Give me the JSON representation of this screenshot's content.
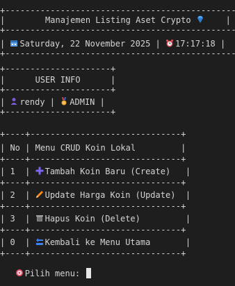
{
  "header": {
    "title": "Manajemen Listing Aset Crypto",
    "datetime_date": "Saturday, 22 November 2025",
    "datetime_time": "17:17:18"
  },
  "user_info": {
    "title": "USER INFO",
    "username": "rendy",
    "role": "ADMIN"
  },
  "menu": {
    "col_no": "No",
    "col_title": "Menu CRUD Koin Lokal",
    "items": [
      {
        "no": "1",
        "label": "Tambah Koin Baru (Create)",
        "icon": "plus-icon"
      },
      {
        "no": "2",
        "label": "Update Harga Koin (Update)",
        "icon": "pencil-icon"
      },
      {
        "no": "3",
        "label": "Hapus Koin (Delete)",
        "icon": "trash-icon"
      },
      {
        "no": "0",
        "label": "Kembali ke Menu Utama",
        "icon": "back-icon"
      }
    ]
  },
  "prompt": {
    "label": "Pilih menu:"
  },
  "colors": {
    "background": "#1e1e1e",
    "text": "#d4d4d4",
    "gem": "#4aa3ff",
    "calendar": "#5aa0e6",
    "clock": "#e0505a",
    "user": "#7b5bd6",
    "medal": "#f0a030",
    "plus": "#7b68ee",
    "pencil": "#ff8c1a",
    "trash": "#a0a0a0",
    "back": "#3b82f6",
    "target": "#e8506a"
  }
}
